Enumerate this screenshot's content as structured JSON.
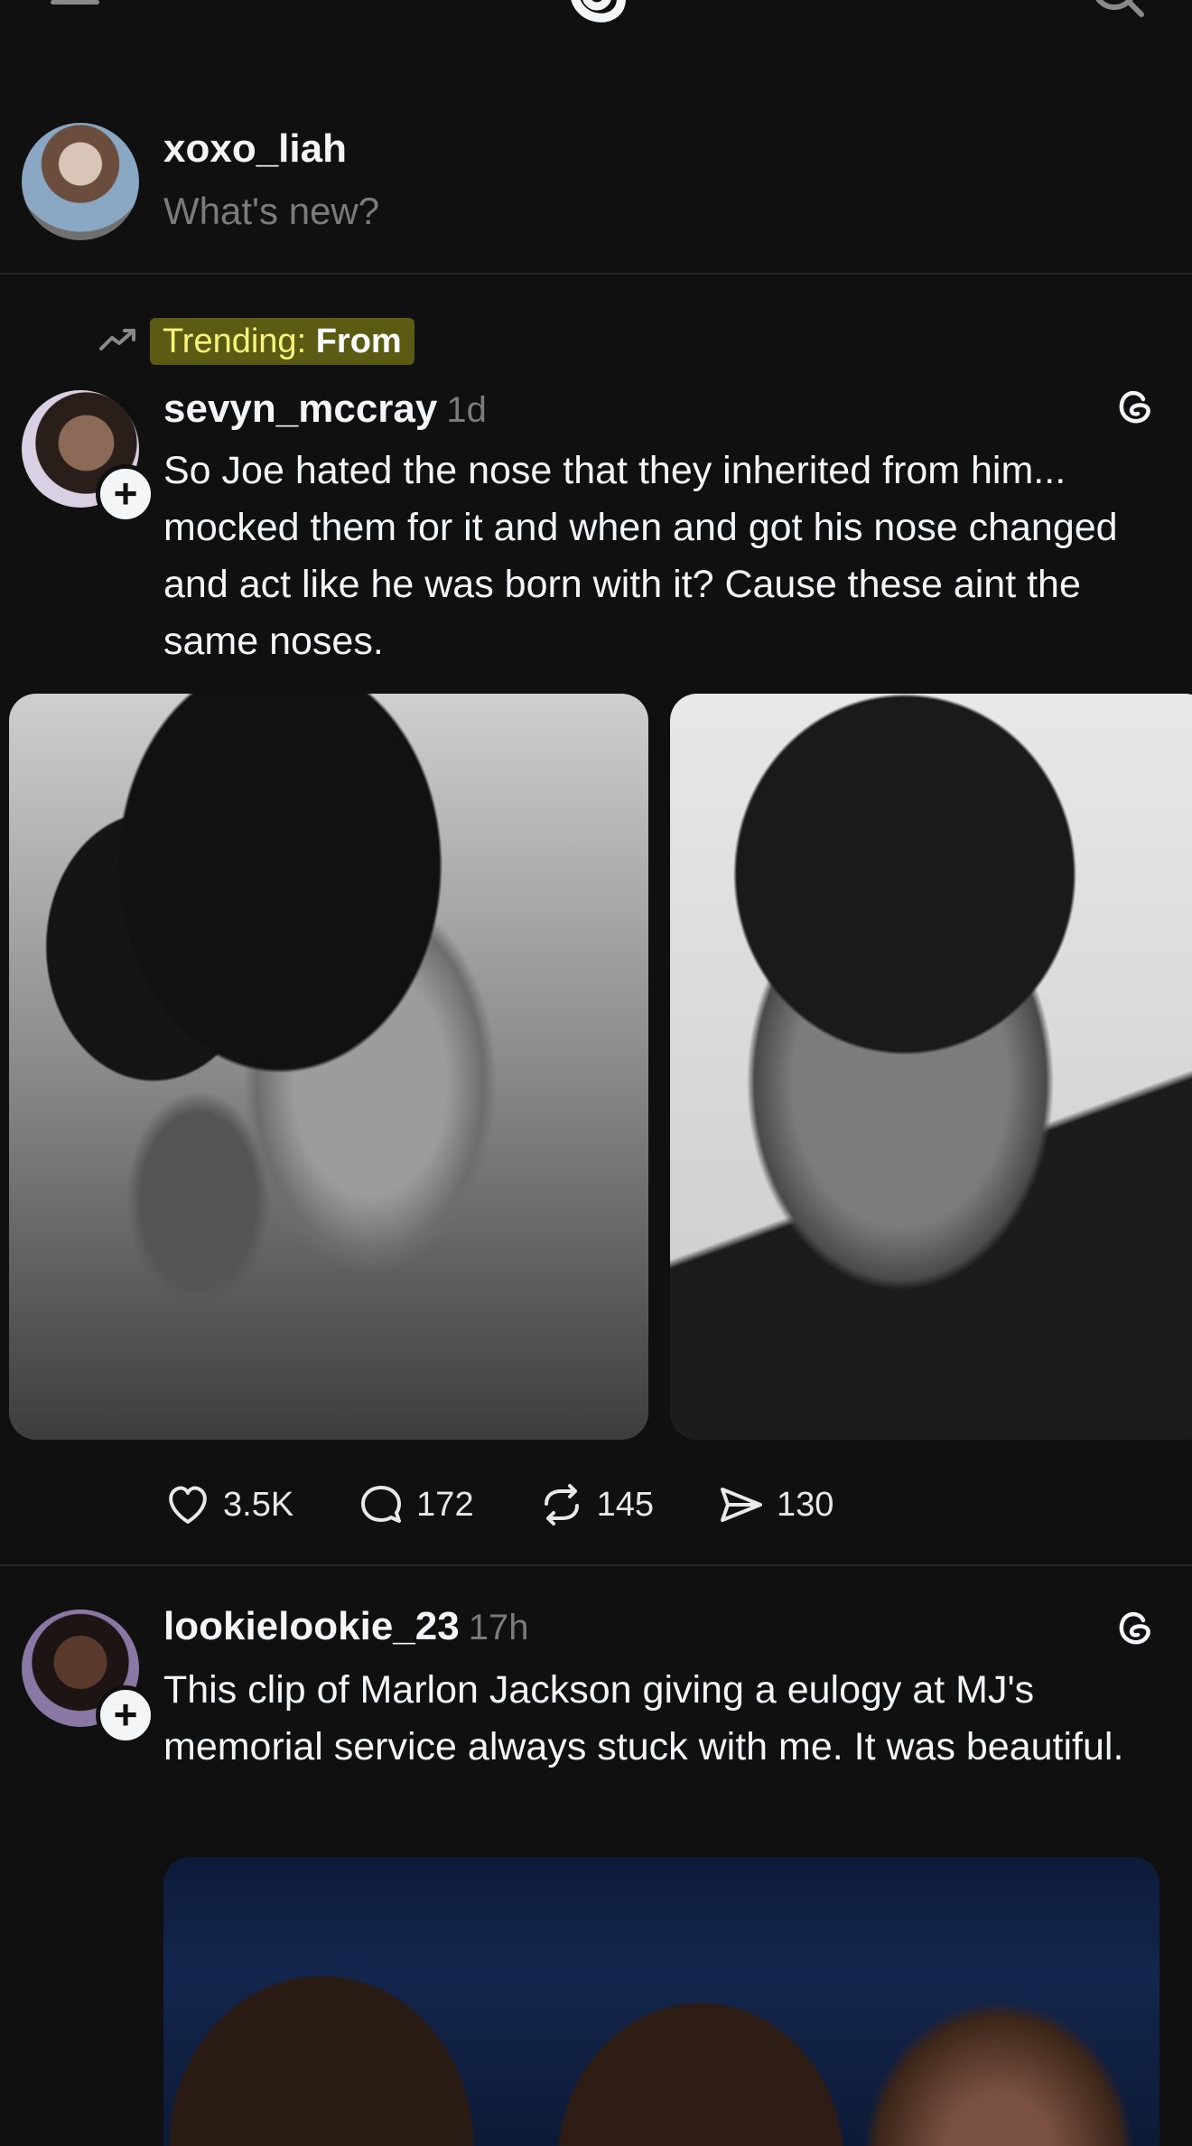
{
  "composer": {
    "username": "xoxo_liah",
    "placeholder": "What's new?"
  },
  "trending": {
    "prefix": "Trending: ",
    "topic": "From"
  },
  "posts": [
    {
      "username": "sevyn_mccray",
      "time": "1d",
      "text": "So Joe hated the nose that they inherited from him... mocked them for it and when and got his nose changed and act like he was born with it? Cause these aint the same noses.",
      "stats": {
        "likes": "3.5K",
        "replies": "172",
        "reposts": "145",
        "shares": "130"
      }
    },
    {
      "username": "lookielookie_23",
      "time": "17h",
      "text": "This clip of Marlon Jackson giving a eulogy at MJ's memorial service always stuck with me. It was beautiful."
    }
  ],
  "colors": {
    "background": "#101010",
    "text": "#f3f5f7",
    "muted": "#7b7b7b",
    "trend_highlight": "#5b5b14"
  },
  "icons": [
    "menu-icon",
    "threads-logo-icon",
    "search-icon",
    "trending-icon",
    "threads-icon",
    "heart-icon",
    "comment-icon",
    "repost-icon",
    "share-icon",
    "plus-icon"
  ]
}
